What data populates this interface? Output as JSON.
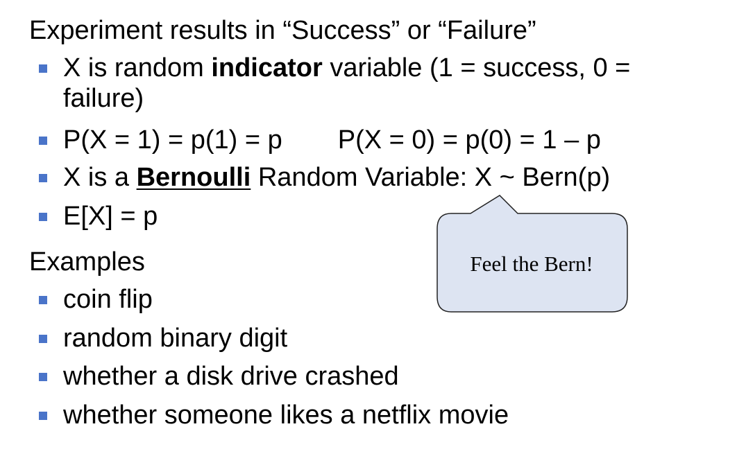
{
  "colors": {
    "bullet": "#4a74c9",
    "callout_fill": "#dde4f2",
    "callout_stroke": "#222222",
    "text": "#000000"
  },
  "headings": {
    "experiment": "Experiment results in “Success” or “Failure”",
    "examples": "Examples"
  },
  "bullets": {
    "indicator": {
      "before": "X is random ",
      "bold": "indicator",
      "after": " variable (1 = success, 0 =",
      "continuation": "failure)"
    },
    "probabilities": {
      "left": "P(X = 1) = p(1) = p",
      "right": "P(X = 0) = p(0) = 1 – p"
    },
    "bernoulli": {
      "before": "X is a ",
      "bold_underlined": "Bernoulli",
      "after": " Random Variable:  X ~ Bern(p)"
    },
    "expectation": "E[X] = p"
  },
  "examples": [
    "coin flip",
    "random binary digit",
    "whether a disk drive crashed",
    "whether someone likes a netflix movie"
  ],
  "callout": {
    "text": "Feel the Bern!"
  }
}
